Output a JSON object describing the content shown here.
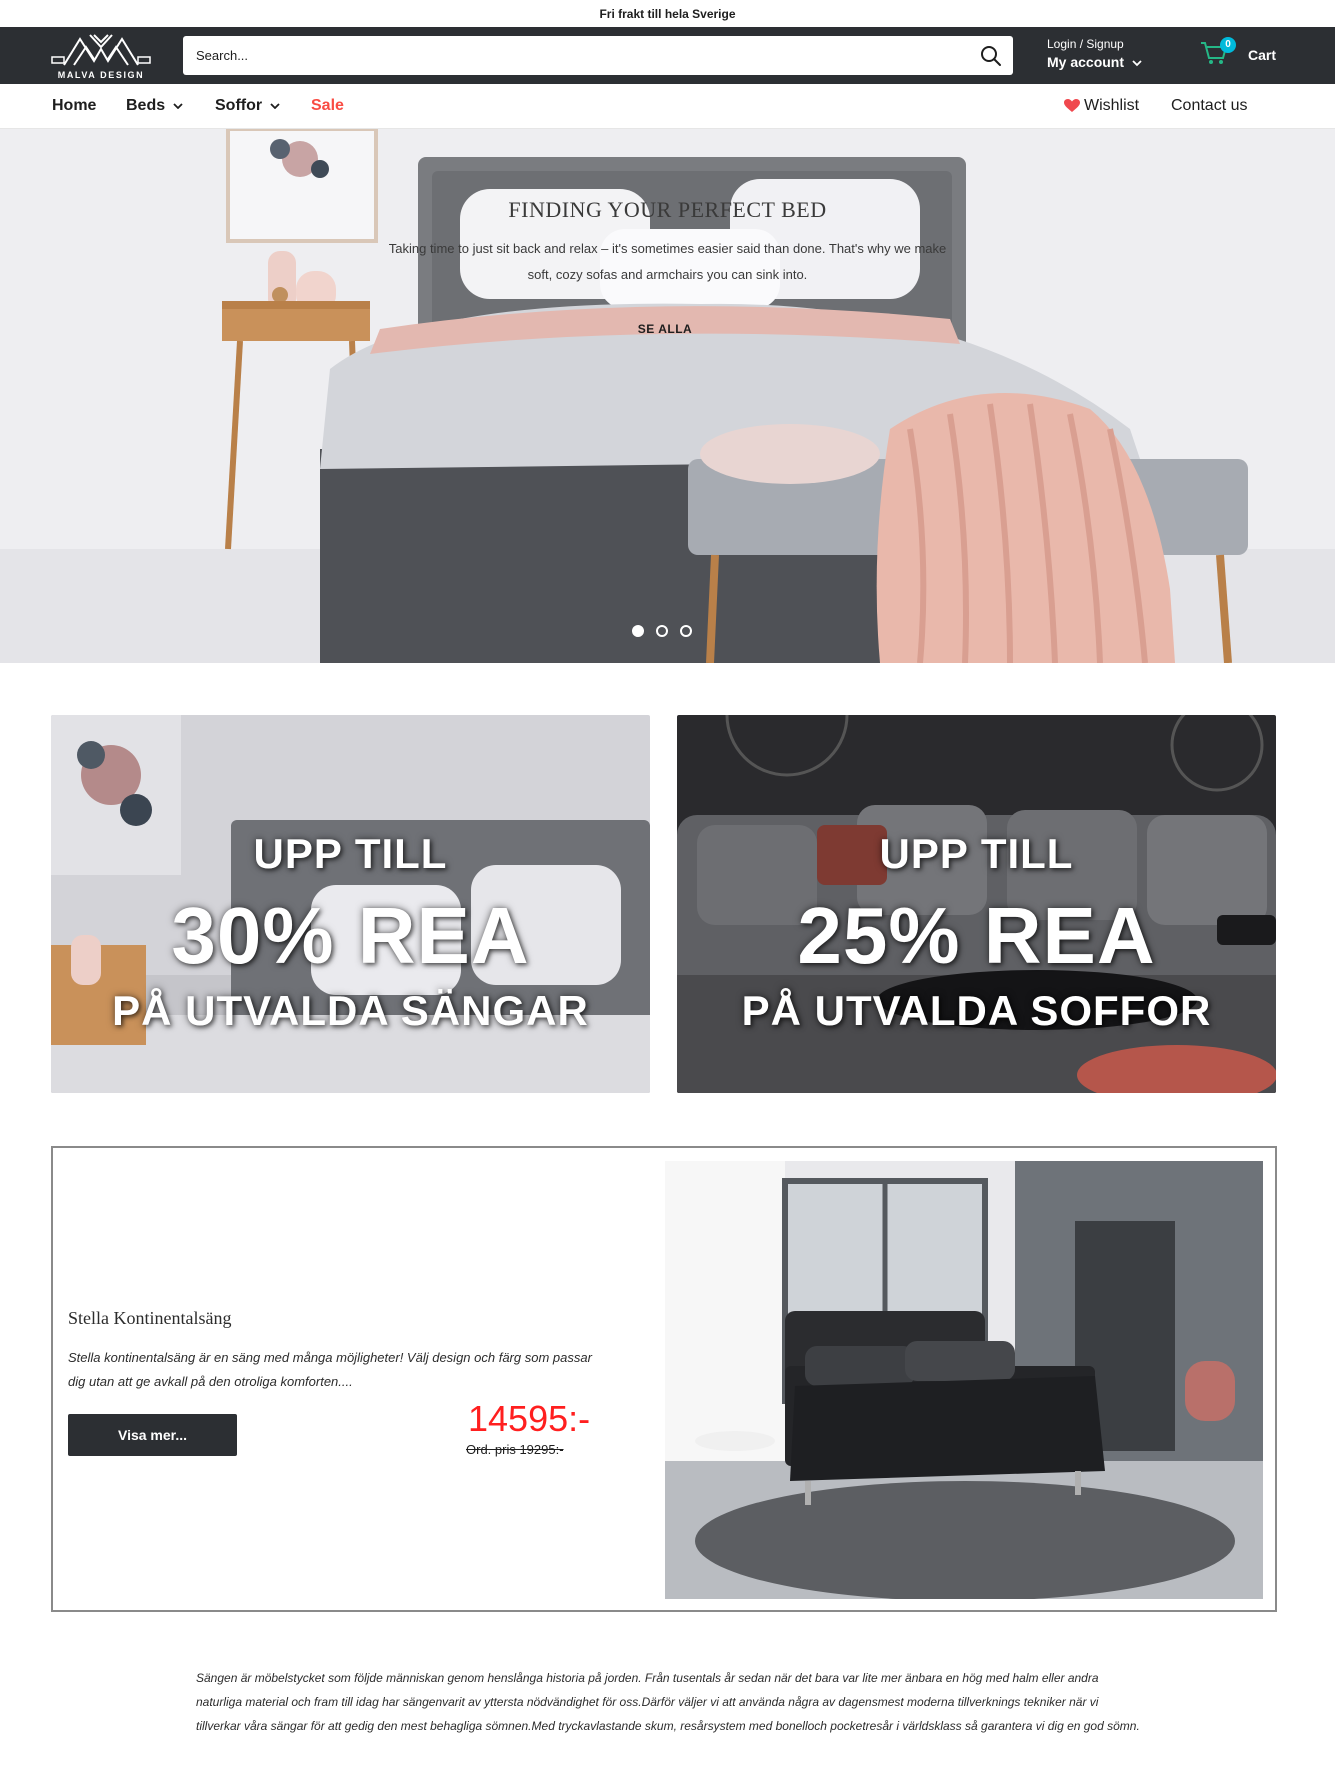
{
  "announcement": "Fri frakt till hela Sverige",
  "header": {
    "logo_text": "MALVA DESIGN",
    "search_placeholder": "Search...",
    "account_small": "Login / Signup",
    "account_big": "My account",
    "cart_label": "Cart",
    "cart_count": "0"
  },
  "nav": {
    "home": "Home",
    "beds": "Beds",
    "soffor": "Soffor",
    "sale": "Sale",
    "wishlist": "Wishlist",
    "contact": "Contact us"
  },
  "hero": {
    "title": "FINDING YOUR PERFECT BED",
    "subtitle": "Taking time to just sit back and relax – it's sometimes easier said than done. That's why we make soft, cozy sofas and armchairs you can sink into.",
    "cta": "SE ALLA",
    "slides": 3,
    "active_slide": 1
  },
  "promos": [
    {
      "line1": "UPP TILL",
      "line2": "30% REA",
      "line3": "PÅ UTVALDA SÄNGAR"
    },
    {
      "line1": "UPP TILL",
      "line2": "25% REA",
      "line3": "PÅ UTVALDA SOFFOR"
    }
  ],
  "feature": {
    "title": "Stella Kontinentalsäng",
    "description": "Stella kontinentalsäng är en säng med många möjligheter! Välj design och färg som passar dig utan att ge avkall på den otroliga komforten....",
    "button": "Visa mer...",
    "price": "14595:-",
    "old_price": "Ord. pris 19295:-"
  },
  "about": "Sängen är möbelstycket som följde människan genom henslånga historia på jorden. Från tusentals år sedan när det bara var lite mer änbara en hög med halm eller andra naturliga material och fram till idag har sängenvarit av yttersta nödvändighet för oss.Därför väljer vi att använda några av dagensmest moderna tillverknings tekniker när vi tillverkar våra sängar för att gedig den mest behagliga sömnen.Med tryckavlastande skum, resårsystem med bonelloch pocketresår i världsklass så garantera vi dig en god sömn.",
  "colors": {
    "header_bg": "#2c2f33",
    "sale_red": "#f94c43",
    "price_red": "#ff1f1f",
    "cart_badge": "#00badb",
    "wishlist_heart": "#f0484e"
  }
}
